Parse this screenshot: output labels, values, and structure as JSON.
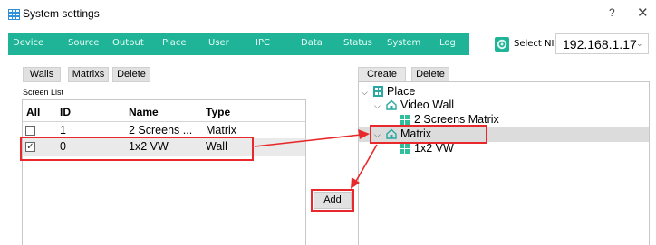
{
  "window": {
    "title": "System settings",
    "help": "?",
    "close": "✕"
  },
  "nav": {
    "tabs": [
      "Device",
      "Source",
      "Output",
      "Place",
      "User",
      "IPC",
      "Data",
      "Status",
      "System",
      "Log"
    ]
  },
  "nic": {
    "label": "Select NIC",
    "value": "192.168.1.17"
  },
  "left_toolbar": {
    "walls": "Walls",
    "matrixs": "Matrixs",
    "delete": "Delete"
  },
  "screen_list": {
    "label": "Screen List",
    "columns": [
      "All",
      "ID",
      "Name",
      "Type"
    ],
    "rows": [
      {
        "checked": false,
        "check_mark": "",
        "id": "1",
        "name": "2 Screens ...",
        "type": "Matrix"
      },
      {
        "checked": true,
        "check_mark": "✓",
        "id": "0",
        "name": "1x2 VW",
        "type": "Wall"
      }
    ]
  },
  "add_button": "Add",
  "right_toolbar": {
    "create_place": "Create Place",
    "delete": "Delete"
  },
  "tree": {
    "root": "Place",
    "nodes": [
      {
        "label": "Video Wall",
        "children": [
          "2 Screens Matrix"
        ]
      },
      {
        "label": "Matrix",
        "children": [
          "1x2 VW"
        ],
        "selected": true
      }
    ]
  },
  "colors": {
    "nav_bg": "#1fb397",
    "annotation": "#e8282a",
    "place_icon": "#2aa7a0",
    "screen_icon": "#2fbf9a"
  },
  "icons": {
    "app": "grid-icon",
    "nic": "gear-icon",
    "place": "home-icon",
    "screen": "screen-grid-icon",
    "expand": "chevron-down-icon"
  }
}
